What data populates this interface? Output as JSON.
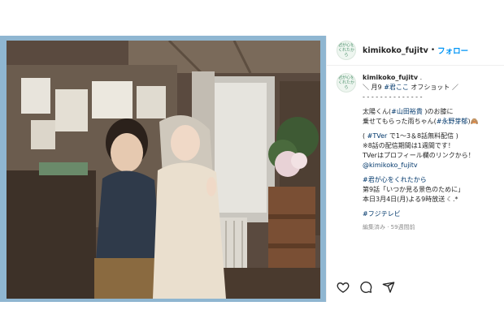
{
  "account": {
    "username": "kimikoko_fujitv",
    "follow_label": "フォロー",
    "separator": "•",
    "avatar_text_line1": "君が心を",
    "avatar_text_line2": "くれたから"
  },
  "caption": {
    "username": "kimikoko_fujitv",
    "line1_after_user": " .",
    "line2_prefix": "＼ 月9 ",
    "line2_tag": "#君ここ",
    "line2_suffix": " オフショット ／",
    "line3": "- - - - - - - - - - - - - -",
    "line4_a": "太陽くん(",
    "line4_tag": "#山田裕貴",
    "line4_b": " )のお膝に",
    "line5_a": "乗せてもらった雨ちゃん(",
    "line5_tag": "#永野芽郁",
    "line5_b": ")🙈",
    "line6_a": "( ",
    "line6_tag": "#TVer",
    "line6_b": " で1〜3＆8話無料配信 )",
    "line7": "※8話の配信期間は1週間です！",
    "line8": "TVerはプロフィール欄のリンクから！",
    "line9_mention": "@kimikoko_fujitv",
    "line10_tag": "#君が心をくれたから",
    "line11": "第9話「いつか見る景色のために」",
    "line12": "本日3月4日(月)よる9時放送 ☾.*",
    "line13_tag": "#フジテレビ"
  },
  "meta": {
    "edited": "編集済み · 59週間前"
  },
  "icons": {
    "like": "heart-icon",
    "comment": "comment-icon",
    "share": "share-icon"
  },
  "colors": {
    "link": "#00376b",
    "follow": "#0095f6",
    "frame": "#8fb6d1"
  }
}
